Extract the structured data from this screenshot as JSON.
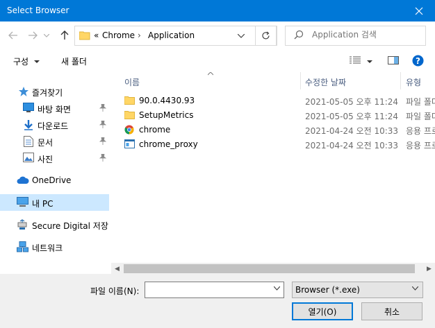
{
  "window": {
    "title": "Select Browser"
  },
  "nav": {
    "address": {
      "prefix": "«",
      "crumbs": [
        "Chrome",
        "Application"
      ]
    },
    "search_placeholder": "Application 검색"
  },
  "toolbar": {
    "organize": "구성",
    "new_folder": "새 폴더"
  },
  "sidebar": {
    "quick_access": "즐겨찾기",
    "items": [
      {
        "label": "바탕 화면",
        "icon": "desktop-icon"
      },
      {
        "label": "다운로드",
        "icon": "download-icon"
      },
      {
        "label": "문서",
        "icon": "document-icon"
      },
      {
        "label": "사진",
        "icon": "pictures-icon"
      }
    ],
    "onedrive": "OneDrive",
    "this_pc": "내 PC",
    "sd": "Secure Digital 저장 공",
    "network": "네트워크"
  },
  "columns": {
    "name": "이름",
    "modified": "수정한 날짜",
    "type": "유형"
  },
  "files": [
    {
      "name": "90.0.4430.93",
      "date": "2021-05-05 오후 11:24",
      "type": "파일 폴더",
      "icon": "folder-icon"
    },
    {
      "name": "SetupMetrics",
      "date": "2021-05-05 오후 11:24",
      "type": "파일 폴더",
      "icon": "folder-icon"
    },
    {
      "name": "chrome",
      "date": "2021-04-24 오전 10:33",
      "type": "응용 프로그램",
      "icon": "chrome-icon"
    },
    {
      "name": "chrome_proxy",
      "date": "2021-04-24 오전 10:33",
      "type": "응용 프로그램",
      "icon": "app-icon"
    }
  ],
  "footer": {
    "filename_label": "파일 이름(N):",
    "filename_value": "",
    "filter_value": "Browser (*.exe)",
    "open_label": "열기(O)",
    "cancel_label": "취소"
  },
  "colors": {
    "accent": "#0078d7",
    "selection": "#cce8ff",
    "header_text": "#4d6082"
  }
}
